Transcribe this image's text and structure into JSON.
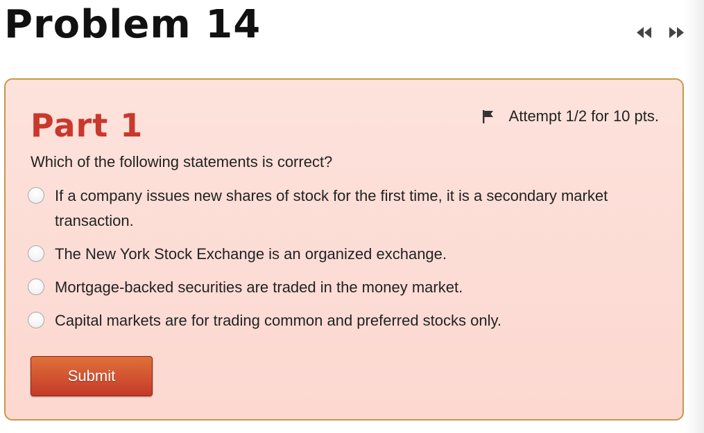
{
  "page": {
    "title": "Problem 14"
  },
  "nav": {
    "prev_icon": "rewind-icon",
    "next_icon": "fast-forward-icon"
  },
  "part": {
    "title": "Part 1",
    "attempt_text": "Attempt 1/2 for 10 pts.",
    "flag_icon": "flag-icon"
  },
  "question": {
    "text": "Which of the following statements is correct?",
    "options": [
      {
        "label": "If a company issues new shares of stock for the first time, it is a secondary market transaction.",
        "selected": false
      },
      {
        "label": "The New York Stock Exchange is an organized exchange.",
        "selected": false
      },
      {
        "label": "Mortgage-backed securities are traded in the money market.",
        "selected": false
      },
      {
        "label": "Capital markets are for trading common and preferred stocks only.",
        "selected": false
      }
    ]
  },
  "actions": {
    "submit_label": "Submit"
  },
  "colors": {
    "part_title": "#c8382c",
    "card_background": "#fde2dc",
    "card_border": "#c39a45",
    "submit_top": "#e0703a",
    "submit_bottom": "#c43a28"
  }
}
